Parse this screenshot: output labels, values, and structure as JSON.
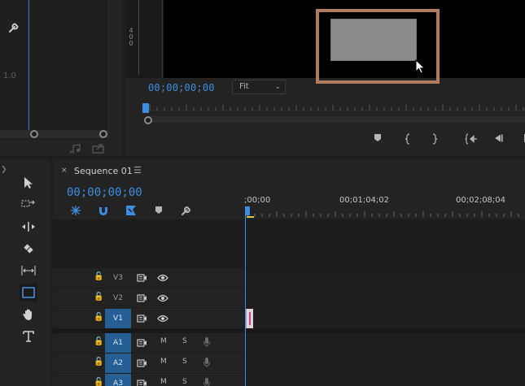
{
  "effect_controls": {
    "value_label": "1.0",
    "bottom_icons": [
      "audio-clip-icon",
      "export-icon"
    ]
  },
  "program_monitor": {
    "audio_meter_labels": [
      "4",
      "0",
      "0"
    ],
    "timecode": "00;00;00;00",
    "zoom_select": {
      "value": "Fit",
      "options": [
        "Fit"
      ]
    },
    "transport_buttons": [
      "marker-icon",
      "mark-in-icon",
      "mark-out-icon",
      "go-to-in-icon",
      "step-back-icon",
      "play-stop-icon"
    ]
  },
  "tools": [
    {
      "name": "selection-tool-icon"
    },
    {
      "name": "track-select-tool-icon"
    },
    {
      "name": "ripple-edit-tool-icon"
    },
    {
      "name": "razor-tool-icon"
    },
    {
      "name": "slip-tool-icon"
    },
    {
      "name": "rectangle-tool-icon",
      "active": true
    },
    {
      "name": "hand-tool-icon"
    },
    {
      "name": "type-tool-icon"
    }
  ],
  "timeline": {
    "tab_close": "×",
    "tab_title": "Sequence 01",
    "tab_menu": "☰",
    "timecode": "00;00;00;00",
    "ruler_labels": [
      ";00;00",
      "00;01;04;02",
      "00;02;08;04"
    ],
    "video_tracks": [
      {
        "name": "V3",
        "selected": false
      },
      {
        "name": "V2",
        "selected": false
      },
      {
        "name": "V1",
        "selected": true
      }
    ],
    "audio_tracks": [
      {
        "name": "A1",
        "mute": "M",
        "solo": "S"
      },
      {
        "name": "A2",
        "mute": "M",
        "solo": "S"
      },
      {
        "name": "A3",
        "mute": "M",
        "solo": "S"
      }
    ]
  },
  "colors": {
    "accent_blue": "#3d8ee0",
    "highlight_border": "#b07c5f",
    "selected_track": "#265f96",
    "clip": "#e2d3e1"
  }
}
